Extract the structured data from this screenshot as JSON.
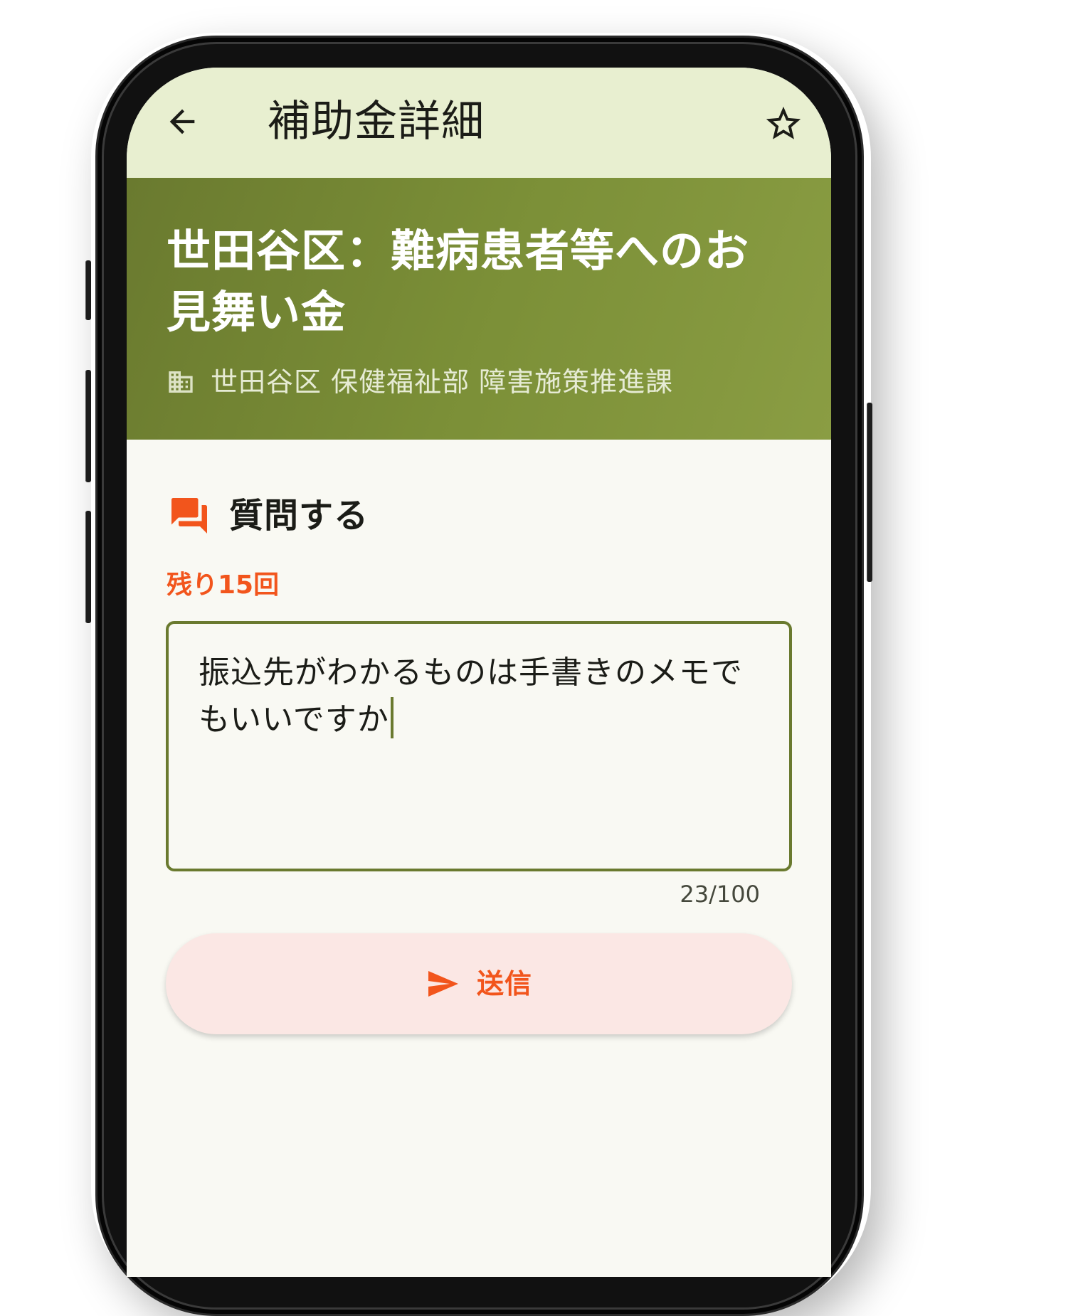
{
  "app_bar": {
    "title": "補助金詳細",
    "back_icon": "arrow-back-icon",
    "favorite_icon": "star-outline-icon"
  },
  "subsidy": {
    "title": "世田谷区：難病患者等へのお見舞い金",
    "organization": "世田谷区 保健福祉部 障害施策推進課",
    "organization_icon": "building-icon"
  },
  "question": {
    "section_title": "質問する",
    "section_icon": "forum-icon",
    "remaining_label": "残り15回",
    "input_value": "振込先がわかるものは手書きのメモでもいいですか",
    "char_count": "23/100",
    "send_label": "送信",
    "send_icon": "send-icon"
  },
  "colors": {
    "top_bar": "#e8efd0",
    "hero": "#7b8f37",
    "accent": "#f2551c",
    "field_border": "#6a7a2f",
    "send_button": "#fbe7e4",
    "background": "#f9f9f3"
  }
}
